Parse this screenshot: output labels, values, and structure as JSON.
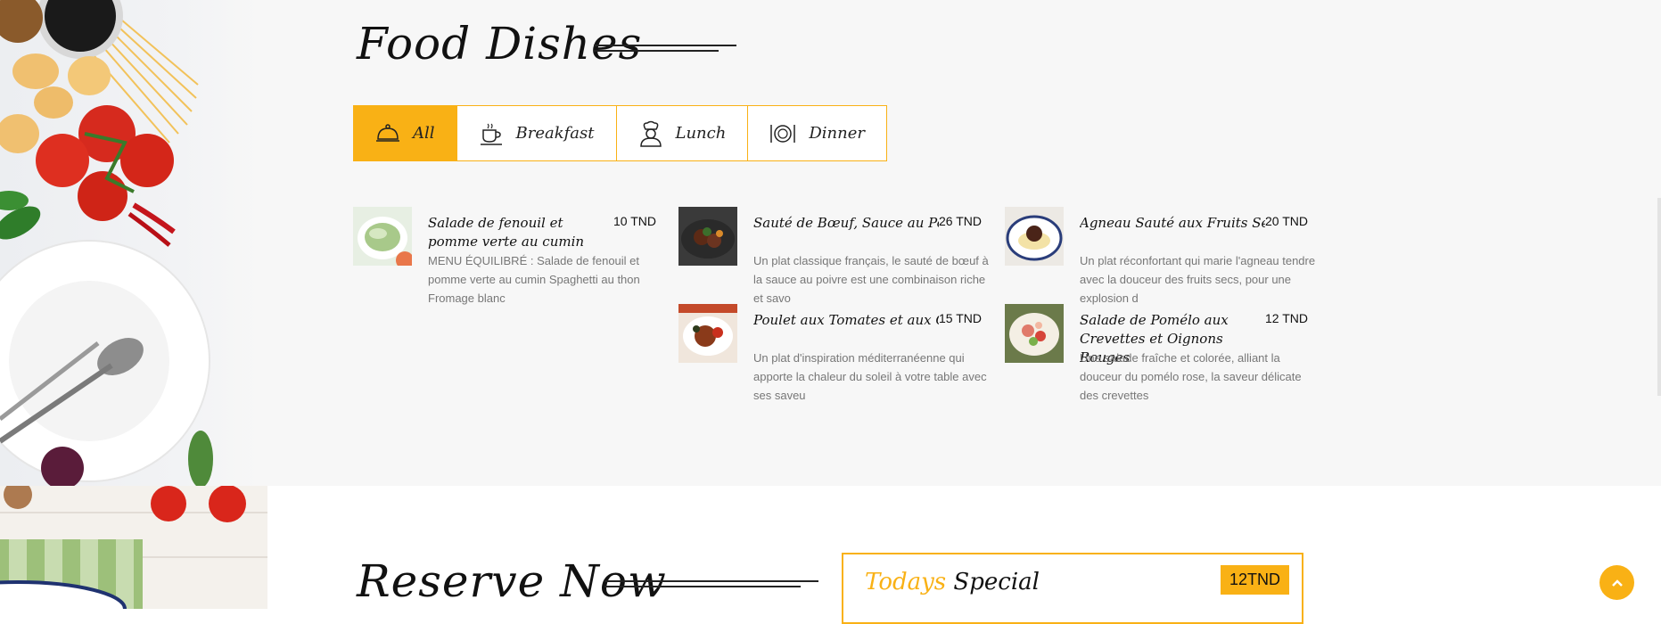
{
  "menu": {
    "title": "Food Dishes",
    "tabs": [
      {
        "label": "All",
        "icon": "cloche-icon",
        "active": true
      },
      {
        "label": "Breakfast",
        "icon": "coffee-cup-icon",
        "active": false
      },
      {
        "label": "Lunch",
        "icon": "chef-icon",
        "active": false
      },
      {
        "label": "Dinner",
        "icon": "plate-cutlery-icon",
        "active": false
      }
    ],
    "dishes": [
      {
        "name": "Salade de fenouil et pomme verte au cumin",
        "price": "10 TND",
        "desc": "MENU ÉQUILIBRÉ : Salade de fenouil et pomme verte au cumin Spaghetti au thon Fromage blanc"
      },
      {
        "name": "Sauté de Bœuf, Sauce au Poivre",
        "price": "26 TND",
        "desc": "Un plat classique français, le sauté de bœuf à la sauce au poivre est une combinaison riche et savo"
      },
      {
        "name": "Agneau Sauté aux Fruits Secs",
        "price": "20 TND",
        "desc": "Un plat réconfortant qui marie l'agneau tendre avec la douceur des fruits secs, pour une explosion d"
      },
      {
        "name": "Poulet aux Tomates et aux Olives",
        "price": "15 TND",
        "desc": "Un plat d'inspiration méditerranéenne qui apporte la chaleur du soleil à votre table avec ses saveu"
      },
      {
        "name": "Salade de Pomélo aux Crevettes et Oignons Rouges",
        "price": "12 TND",
        "desc": "Une salade fraîche et colorée, alliant la douceur du pomélo rose, la saveur délicate des crevettes"
      }
    ]
  },
  "reserve": {
    "title": "Reserve Now",
    "special": {
      "highlight": "Todays",
      "label": "Special",
      "price": "12TND"
    }
  },
  "colors": {
    "accent": "#f9b115",
    "section_bg": "#f7f7f7",
    "text": "#111111",
    "muted": "#777777"
  }
}
